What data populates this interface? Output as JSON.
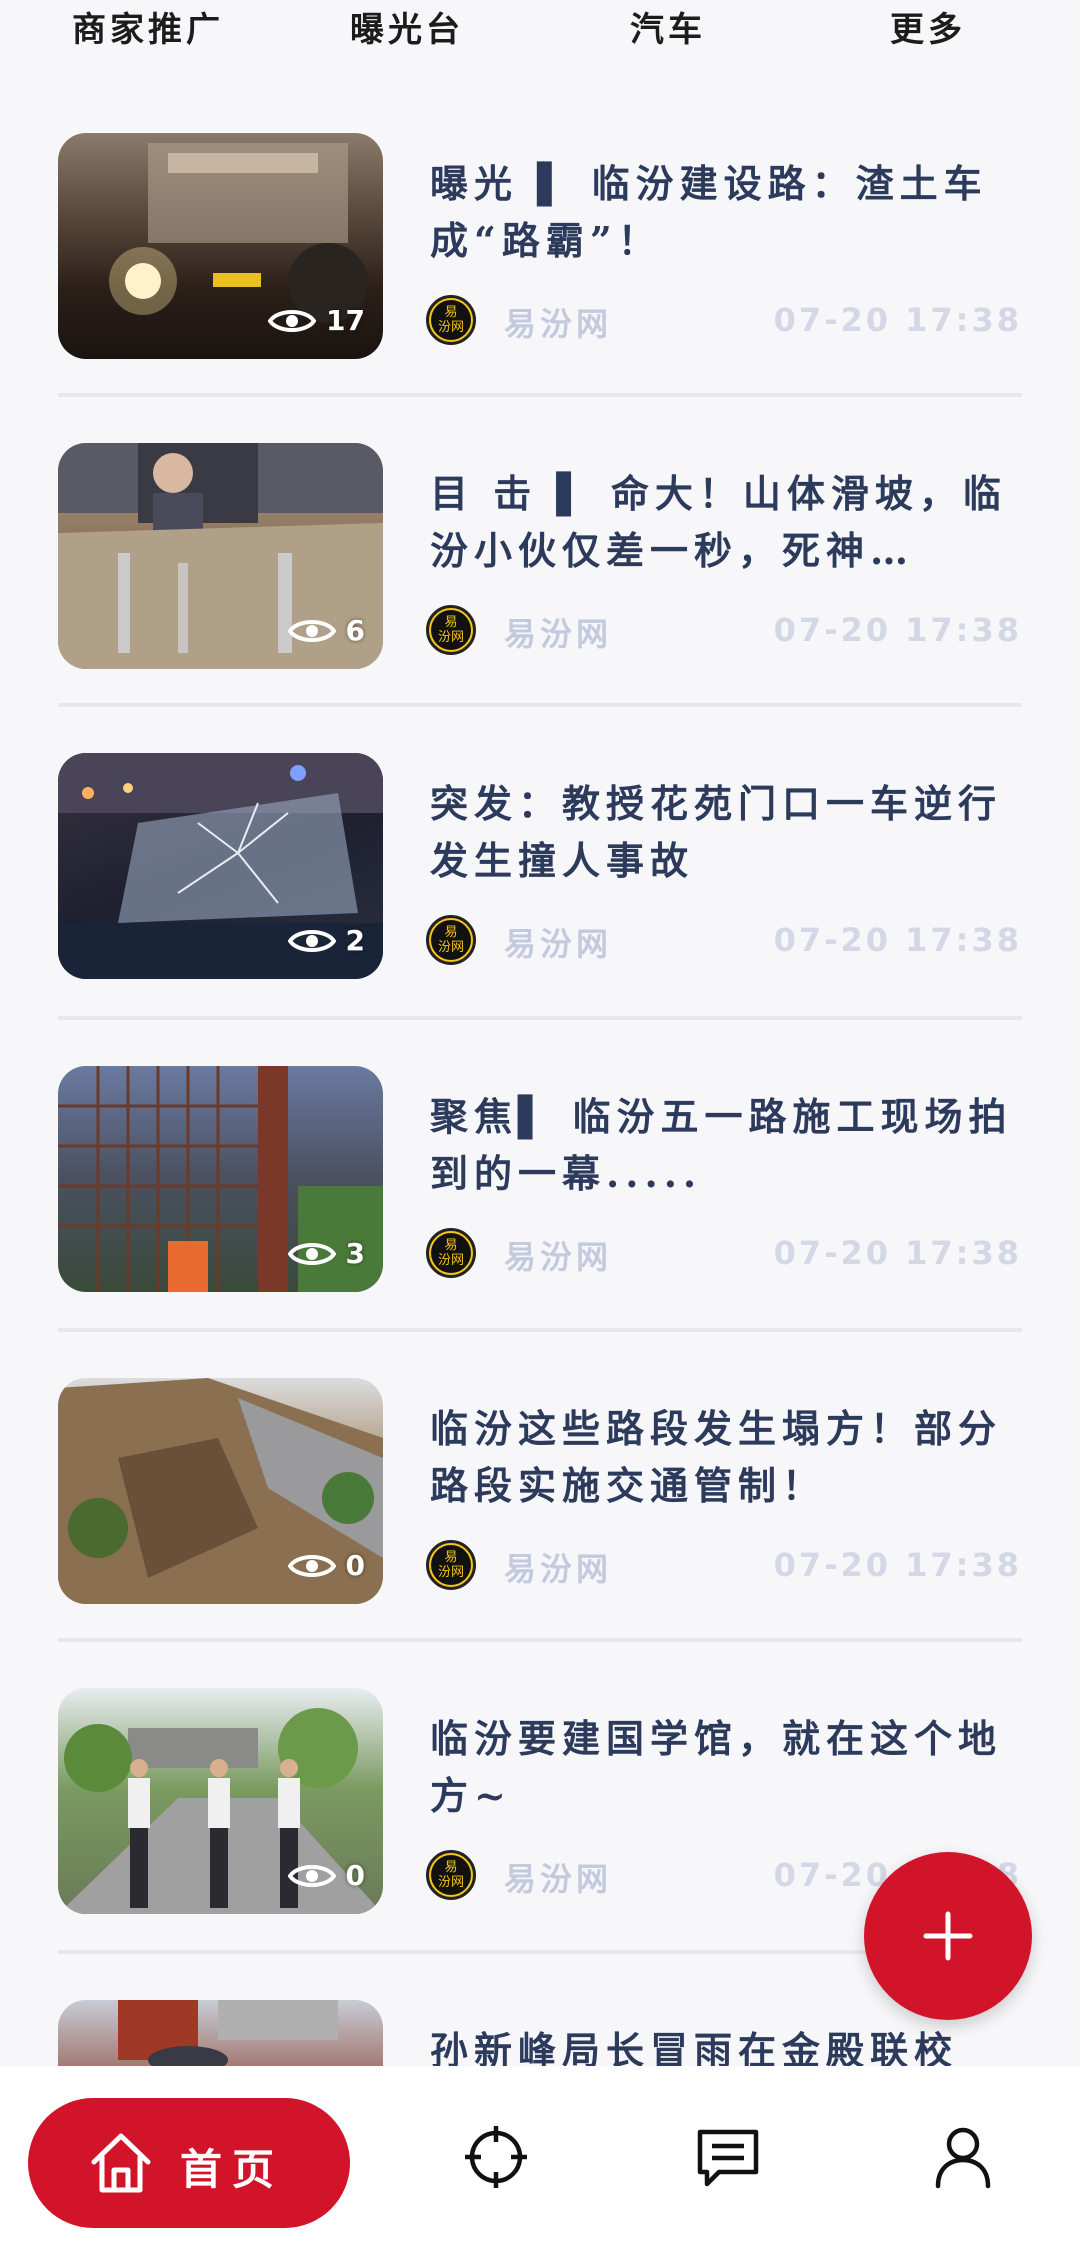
{
  "top_tabs": [
    "商家推广",
    "曝光台",
    "汽车",
    "更多"
  ],
  "articles": [
    {
      "title": "曝光 ▌ 临汾建设路：渣土车成“路霸”！",
      "views": "17",
      "source": "易汾网",
      "time": "07-20 17:38",
      "thumb": "truck-night"
    },
    {
      "title": "目 击 ▌ 命大！山体滑坡，临汾小伙仅差一秒，死神…",
      "views": "6",
      "source": "易汾网",
      "time": "07-20 17:38",
      "thumb": "muddy-car"
    },
    {
      "title": "突发：教授花苑门口一车逆行发生撞人事故",
      "views": "2",
      "source": "易汾网",
      "time": "07-20 17:38",
      "thumb": "broken-windshield"
    },
    {
      "title": "聚焦▌ 临汾五一路施工现场拍到的一幕.....",
      "views": "3",
      "source": "易汾网",
      "time": "07-20 17:38",
      "thumb": "construction-site"
    },
    {
      "title": "临汾这些路段发生塌方！部分路段实施交通管制！",
      "views": "0",
      "source": "易汾网",
      "time": "07-20 17:38",
      "thumb": "landslide"
    },
    {
      "title": "临汾要建国学馆，就在这个地方~",
      "views": "0",
      "source": "易汾网",
      "time": "07-20 17:38",
      "thumb": "officials-visit"
    },
    {
      "title": "孙新峰局长冒雨在金殿联校",
      "views": "",
      "source": "",
      "time": "",
      "thumb": "school-rain"
    }
  ],
  "logo_text": "易\n汾网",
  "bottom_nav": {
    "home_label": "首页"
  },
  "colors": {
    "accent": "#d2142a",
    "title": "#2c3a5c",
    "meta": "#c4cade"
  }
}
